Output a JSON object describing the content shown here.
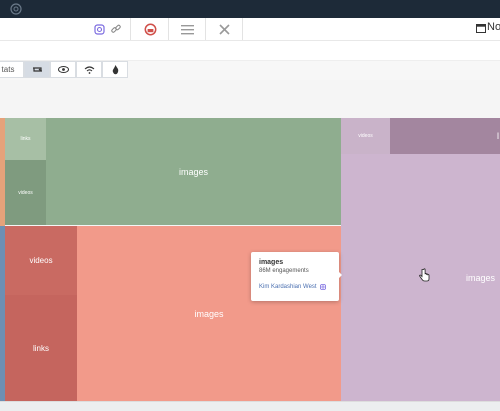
{
  "toolbar": {
    "date_label": "Nov",
    "icons": [
      "instagram-icon",
      "link-icon",
      "dashboard-icon",
      "list-icon",
      "tools-icon",
      "calendar-icon"
    ]
  },
  "tabs": {
    "stats_label": "tats",
    "icons": [
      "repost-icon",
      "eye-icon",
      "wifi-icon",
      "fire-icon"
    ]
  },
  "treemap": {
    "cells": [
      {
        "id": "g-links",
        "label": "links",
        "color": "#a7bfa5"
      },
      {
        "id": "g-videos",
        "label": "videos",
        "color": "#7f9b7f"
      },
      {
        "id": "g-images",
        "label": "images",
        "color": "#8fad8f"
      },
      {
        "id": "r-videos",
        "label": "videos",
        "color": "#c96a62"
      },
      {
        "id": "r-links",
        "label": "links",
        "color": "#c5655e"
      },
      {
        "id": "r-images",
        "label": "images",
        "color": "#f29a8a"
      },
      {
        "id": "p-videos",
        "label": "videos",
        "color": "#c9b3c9"
      },
      {
        "id": "p-dark",
        "label": "l",
        "color": "#a3869f"
      },
      {
        "id": "p-images",
        "label": "images",
        "color": "#cdb5cf"
      }
    ]
  },
  "tooltip": {
    "title": "images",
    "value": "86M engagements",
    "user": "Kim Kardashian West"
  }
}
